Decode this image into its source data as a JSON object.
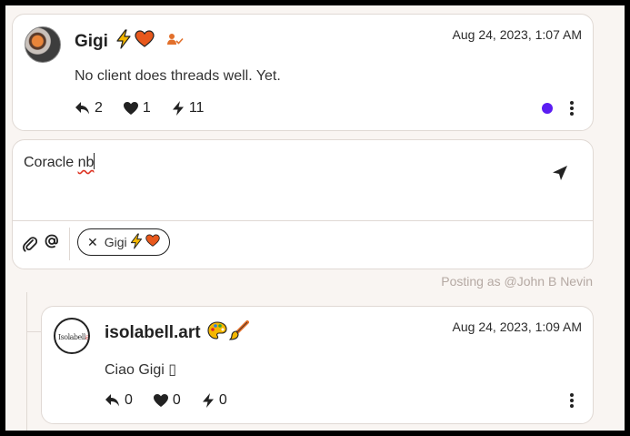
{
  "post1": {
    "author": "Gigi",
    "author_emojis": [
      "bolt",
      "heart"
    ],
    "verified_icon": "user-check-icon",
    "timestamp": "Aug 24, 2023, 1:07 AM",
    "content": "No client does threads well. Yet.",
    "replies": "2",
    "likes": "1",
    "zaps": "11",
    "status_dot_color": "#5b1df2"
  },
  "composer": {
    "text_before": "Coracle ",
    "text_misspelled": "nb",
    "mention_chip": "Gigi",
    "attach_icon": "paperclip-icon",
    "mention_icon": "at-icon",
    "send_icon": "send-icon"
  },
  "posting_as": "Posting as @John B Nevin",
  "post2": {
    "author": "isolabell.art",
    "author_emojis": [
      "palette",
      "paintbrush"
    ],
    "avatar_signature": "Isolabell",
    "avatar_signature_accent": "art",
    "timestamp": "Aug 24, 2023, 1:09 AM",
    "content": "Ciao Gigi ▯",
    "replies": "0",
    "likes": "0",
    "zaps": "0"
  },
  "colors": {
    "background": "#f9f5f2",
    "card_border": "#e0d9d4",
    "bolt": "#f5b700",
    "heart": "#e8581c",
    "accent_orange": "#e2702b",
    "muted_text": "#b5a9a3"
  }
}
